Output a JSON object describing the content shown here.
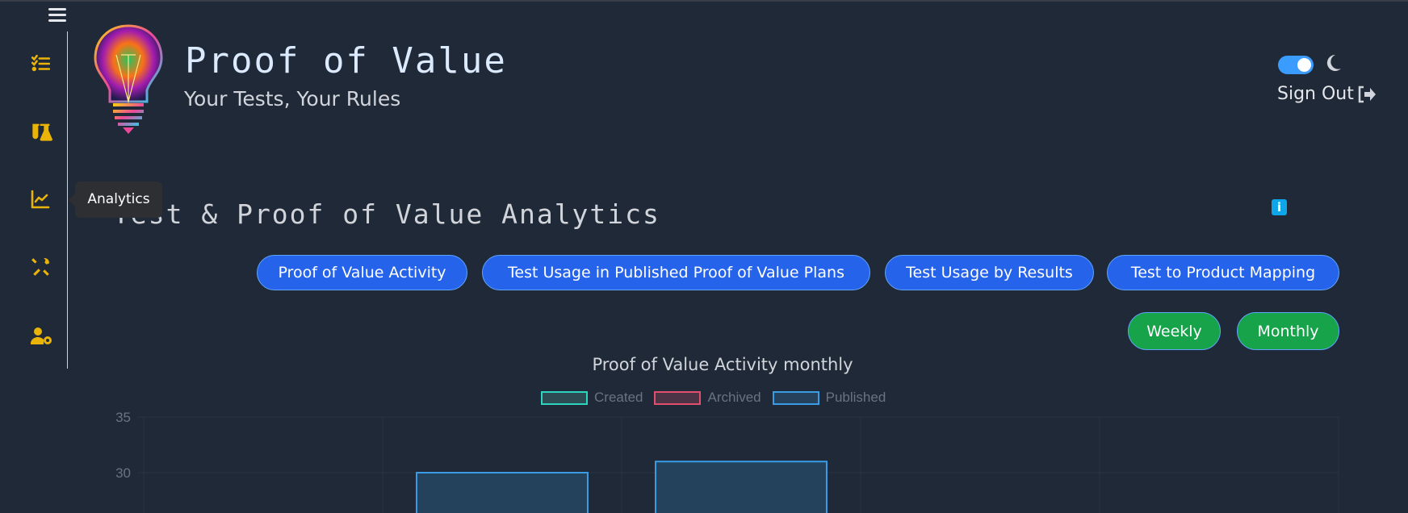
{
  "header": {
    "title": "Proof of Value",
    "subtitle": "Your Tests, Your Rules",
    "sign_out": "Sign Out",
    "dark_mode_enabled": true
  },
  "sidebar": {
    "items": [
      {
        "icon": "checklist-icon",
        "label": ""
      },
      {
        "icon": "flask-icon",
        "label": ""
      },
      {
        "icon": "chart-line-icon",
        "label": "Analytics"
      },
      {
        "icon": "tools-icon",
        "label": ""
      },
      {
        "icon": "user-gear-icon",
        "label": ""
      }
    ],
    "tooltip": "Analytics"
  },
  "main": {
    "heading": "Test & Proof of Value Analytics",
    "info_label": "i",
    "report_buttons": [
      "Proof of Value Activity",
      "Test Usage in Published Proof of Value Plans",
      "Test Usage by Results",
      "Test to Product Mapping"
    ],
    "period_buttons": [
      "Weekly",
      "Monthly"
    ]
  },
  "colors": {
    "background": "#1f2937",
    "sidebar_icon": "#eab308",
    "report_button": "#2563eb",
    "period_button": "#16a34a",
    "created": "#2dd4bf",
    "archived": "#f43f5e",
    "published": "#3b9ce6"
  },
  "chart_data": {
    "type": "bar",
    "title": "Proof of Value Activity monthly",
    "legend": [
      "Created",
      "Archived",
      "Published"
    ],
    "legend_position": "top",
    "y_ticks": [
      35,
      30
    ],
    "ylim_top": 35,
    "grid": true,
    "series": [
      {
        "name": "Published",
        "values": [
          null,
          30,
          31,
          null,
          null
        ]
      }
    ]
  }
}
